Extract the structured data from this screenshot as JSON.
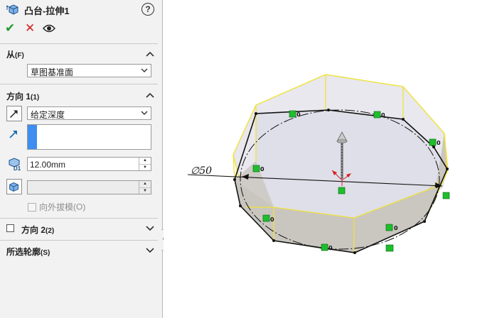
{
  "panel": {
    "title": "凸台-拉伸1",
    "help_symbol": "?",
    "actions": {
      "ok": "✔",
      "cancel": "✕"
    },
    "from_section": {
      "label": "从",
      "shortcut": "(F)",
      "start_condition": "草图基准面"
    },
    "direction1_section": {
      "label": "方向 1",
      "shortcut": "(1)",
      "end_condition": "给定深度",
      "depth_value": "12.00mm",
      "draft_value": "",
      "draft_outward_label": "向外拔模",
      "draft_outward_shortcut": "(O)"
    },
    "direction2_section": {
      "label": "方向 2",
      "shortcut": "(2)"
    },
    "contours_section": {
      "label": "所选轮廓",
      "shortcut": "(S)"
    }
  },
  "viewport": {
    "dimension_label": "∅50",
    "colors": {
      "extrude_edge": "#f0e23a",
      "face_fill": "#cfcbc6",
      "top_face": "#dcdfe8",
      "handle": "#1dbf2a"
    }
  }
}
